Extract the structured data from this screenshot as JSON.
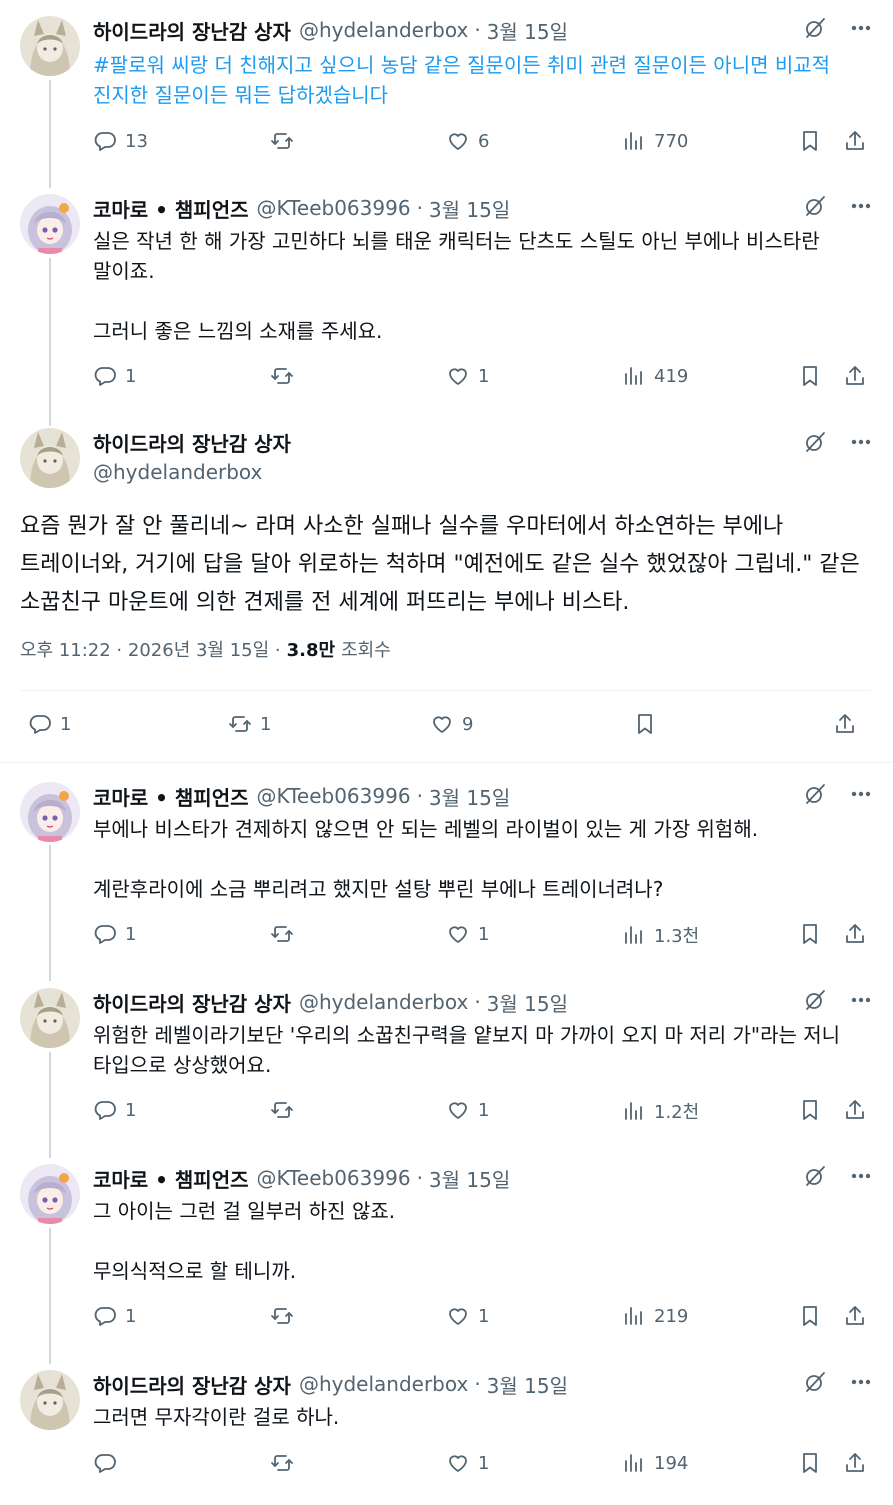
{
  "accounts": {
    "hydra": {
      "name": "하이드라의 장난감 상자",
      "handle": "@hydelanderbox"
    },
    "komaro": {
      "name": "코마로 • 챔피언즈",
      "handle": "@KTeeb063996"
    }
  },
  "date": "3월 15일",
  "tweets": [
    {
      "body_hashtag": "#팔로워 씨랑 더 친해지고 싶으니 농담 같은 질문이든 취미 관련 질문이든 아니면 비교적 진지한 질문이든 뭐든 답하겠습니다",
      "replies": "13",
      "reposts": "",
      "likes": "6",
      "views": "770"
    },
    {
      "body": [
        "실은 작년 한 해 가장 고민하다 뇌를 태운 캐릭터는 단츠도 스틸도 아닌 부에나 비스타란 말이죠.",
        "그러니 좋은 느낌의 소재를 주세요."
      ],
      "replies": "1",
      "reposts": "",
      "likes": "1",
      "views": "419"
    }
  ],
  "main": {
    "body": "요즘 뭔가 잘 안 풀리네~ 라며 사소한 실패나 실수를 우마터에서 하소연하는 부에나 트레이너와, 거기에 답을 달아 위로하는 척하며 \"예전에도 같은 실수 했었잖아 그립네.\" 같은 소꿉친구 마운트에 의한 견제를 전 세계에 퍼뜨리는 부에나 비스타.",
    "time": "오후 11:22 · 2026년 3월 15일 ·",
    "views_count": "3.8만",
    "views_label": "조회수",
    "replies": "1",
    "reposts": "1",
    "likes": "9"
  },
  "replies": [
    {
      "body": [
        "부에나 비스타가 견제하지 않으면 안 되는 레벨의 라이벌이 있는 게 가장 위험해.",
        "계란후라이에 소금 뿌리려고 했지만 설탕 뿌린 부에나 트레이너려나?"
      ],
      "replies": "1",
      "likes": "1",
      "views": "1.3천"
    },
    {
      "body": [
        "위험한 레벨이라기보단 '우리의 소꿉친구력을 얕보지 마 가까이 오지 마 저리 가\"라는 저니 타입으로 상상했어요."
      ],
      "replies": "1",
      "likes": "1",
      "views": "1.2천"
    },
    {
      "body": [
        "그 아이는 그런 걸 일부러 하진 않죠.",
        "무의식적으로 할 테니까."
      ],
      "replies": "1",
      "likes": "1",
      "views": "219"
    },
    {
      "body": [
        "그러면 무자각이란 걸로 하나."
      ],
      "replies": "",
      "likes": "1",
      "views": "194"
    }
  ],
  "colors": {
    "accent": "#1d9bf0",
    "secondary_text": "#536471",
    "line": "#cfd9de"
  },
  "icons": [
    "reply-icon",
    "repost-icon",
    "like-icon",
    "views-icon",
    "bookmark-icon",
    "share-icon",
    "grok-icon",
    "more-icon"
  ]
}
